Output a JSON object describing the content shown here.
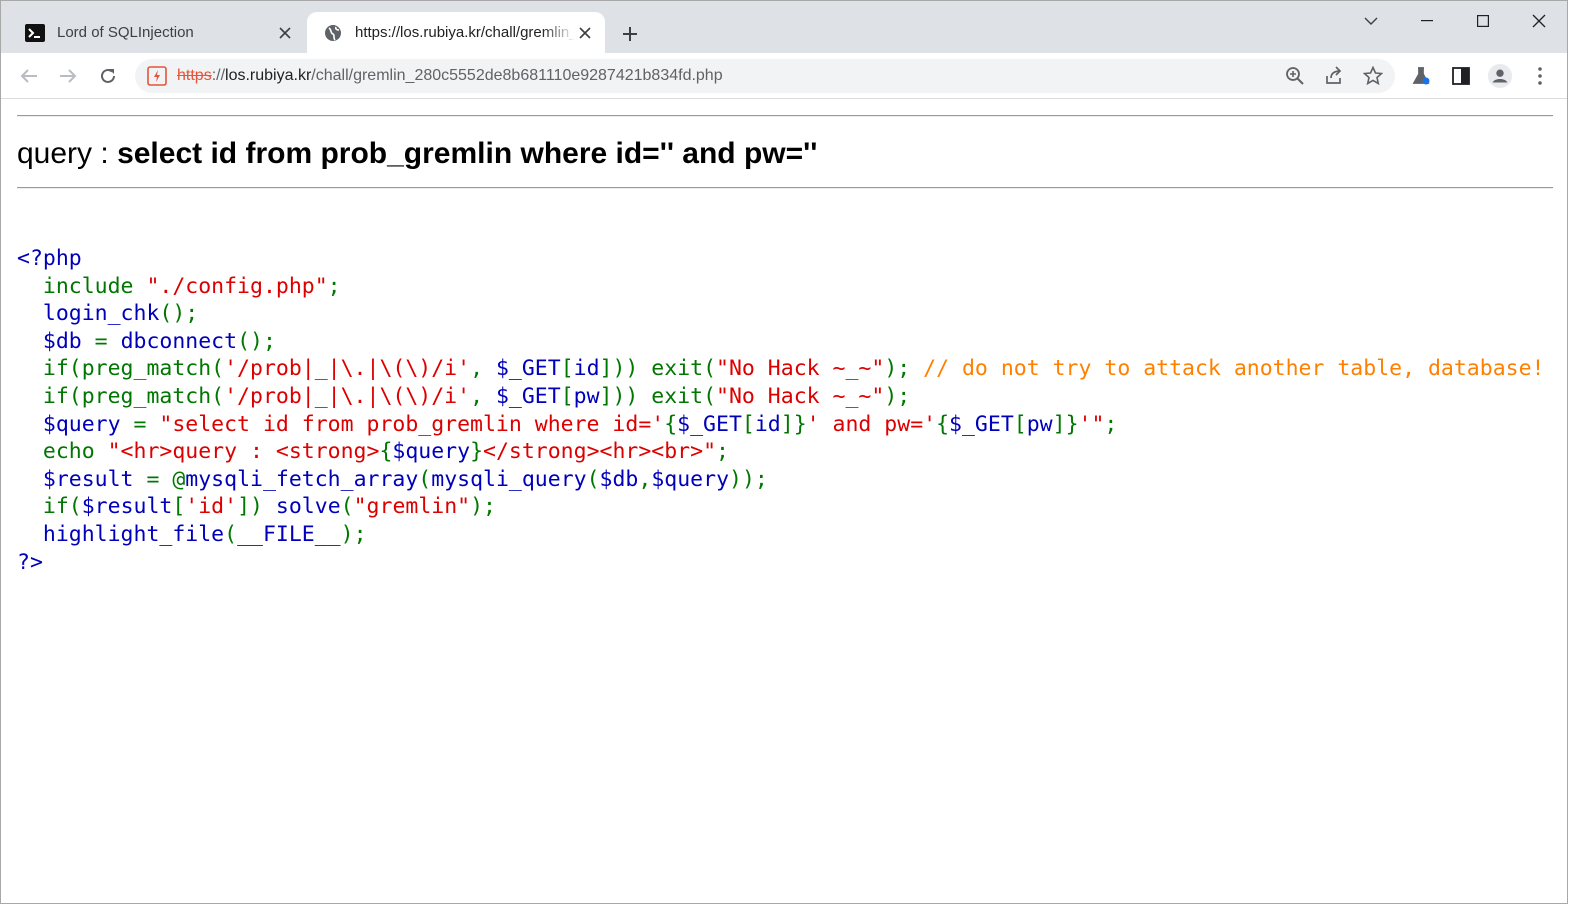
{
  "browser": {
    "tabs": [
      {
        "title": "Lord of SQLInjection",
        "icon": "terminal-icon",
        "active": false
      },
      {
        "title": "https://los.rubiya.kr/chall/gremlin_280c5552de8b681110e9287421b834fd.php",
        "icon": "globe-icon",
        "active": true
      }
    ],
    "address": {
      "scheme": "https",
      "rest": "://",
      "host": "los.rubiya.kr",
      "path": "/chall/gremlin_280c5552de8b681110e9287421b834fd.php"
    },
    "colors": {
      "tabstrip": "#dee1e6",
      "omnibox": "#f1f3f4",
      "insecure": "#e2563a"
    }
  },
  "page": {
    "query_label": "query : ",
    "query_sql": "select id from prob_gremlin where id='' and pw=''",
    "code_lines": [
      [
        [
          "def",
          "<?php"
        ]
      ],
      [
        [
          "def",
          "  "
        ],
        [
          "key",
          "include "
        ],
        [
          "str",
          "\"./config.php\""
        ],
        [
          "key",
          ";"
        ]
      ],
      [
        [
          "def",
          "  login_chk"
        ],
        [
          "key",
          "();"
        ]
      ],
      [
        [
          "def",
          "  $db "
        ],
        [
          "key",
          "= "
        ],
        [
          "def",
          "dbconnect"
        ],
        [
          "key",
          "();"
        ]
      ],
      [
        [
          "key",
          "  if(preg_match("
        ],
        [
          "str",
          "'/prob|_|\\.|\\(\\)/i'"
        ],
        [
          "key",
          ", "
        ],
        [
          "def",
          "$_GET"
        ],
        [
          "key",
          "["
        ],
        [
          "def",
          "id"
        ],
        [
          "key",
          "])) exit("
        ],
        [
          "str",
          "\"No Hack ~_~\""
        ],
        [
          "key",
          "); "
        ],
        [
          "com",
          "// do not try to attack another table, database!"
        ]
      ],
      [
        [
          "key",
          "  if(preg_match("
        ],
        [
          "str",
          "'/prob|_|\\.|\\(\\)/i'"
        ],
        [
          "key",
          ", "
        ],
        [
          "def",
          "$_GET"
        ],
        [
          "key",
          "["
        ],
        [
          "def",
          "pw"
        ],
        [
          "key",
          "])) exit("
        ],
        [
          "str",
          "\"No Hack ~_~\""
        ],
        [
          "key",
          ");"
        ]
      ],
      [
        [
          "def",
          "  $query "
        ],
        [
          "key",
          "= "
        ],
        [
          "str",
          "\"select id from prob_gremlin where id='"
        ],
        [
          "key",
          "{"
        ],
        [
          "def",
          "$_GET"
        ],
        [
          "key",
          "["
        ],
        [
          "def",
          "id"
        ],
        [
          "key",
          "]}"
        ],
        [
          "str",
          "' and pw='"
        ],
        [
          "key",
          "{"
        ],
        [
          "def",
          "$_GET"
        ],
        [
          "key",
          "["
        ],
        [
          "def",
          "pw"
        ],
        [
          "key",
          "]}"
        ],
        [
          "str",
          "'\""
        ],
        [
          "key",
          ";"
        ]
      ],
      [
        [
          "key",
          "  echo "
        ],
        [
          "str",
          "\"<hr>query : <strong>"
        ],
        [
          "key",
          "{"
        ],
        [
          "def",
          "$query"
        ],
        [
          "key",
          "}"
        ],
        [
          "str",
          "</strong><hr><br>\""
        ],
        [
          "key",
          ";"
        ]
      ],
      [
        [
          "def",
          "  $result "
        ],
        [
          "key",
          "= @"
        ],
        [
          "def",
          "mysqli_fetch_array"
        ],
        [
          "key",
          "("
        ],
        [
          "def",
          "mysqli_query"
        ],
        [
          "key",
          "("
        ],
        [
          "def",
          "$db"
        ],
        [
          "key",
          ","
        ],
        [
          "def",
          "$query"
        ],
        [
          "key",
          "));"
        ]
      ],
      [
        [
          "key",
          "  if("
        ],
        [
          "def",
          "$result"
        ],
        [
          "key",
          "["
        ],
        [
          "str",
          "'id'"
        ],
        [
          "key",
          "]) "
        ],
        [
          "def",
          "solve"
        ],
        [
          "key",
          "("
        ],
        [
          "str",
          "\"gremlin\""
        ],
        [
          "key",
          ");"
        ]
      ],
      [
        [
          "def",
          "  highlight_file"
        ],
        [
          "key",
          "("
        ],
        [
          "def",
          "__FILE__"
        ],
        [
          "key",
          ");"
        ]
      ],
      [
        [
          "def",
          "?>"
        ]
      ]
    ],
    "syntax_colors": {
      "def": "#0000BB",
      "key": "#007700",
      "str": "#DD0000",
      "com": "#FF8000"
    }
  }
}
